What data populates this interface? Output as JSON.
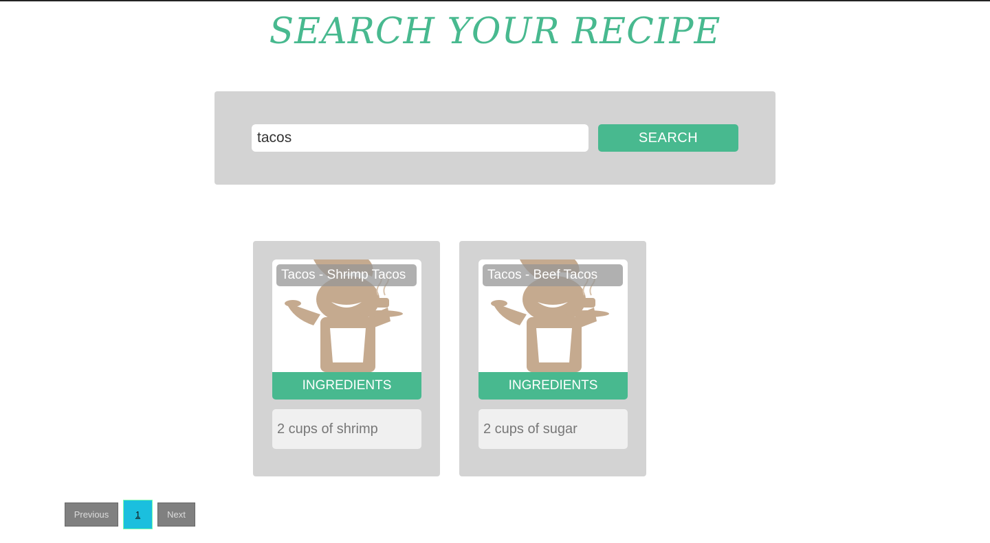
{
  "header": {
    "title": "SEARCH YOUR RECIPE"
  },
  "search": {
    "value": "tacos",
    "button_label": "SEARCH"
  },
  "cards": [
    {
      "title": "Tacos - Shrimp Tacos",
      "image_icon": "chef-waiter-icon",
      "button_label": "INGREDIENTS",
      "ingredients": "2 cups of shrimp"
    },
    {
      "title": "Tacos - Beef Tacos",
      "image_icon": "chef-waiter-icon",
      "button_label": "INGREDIENTS",
      "ingredients": "2 cups of sugar"
    }
  ],
  "pagination": {
    "previous_label": "Previous",
    "current_page": "1",
    "next_label": "Next"
  },
  "colors": {
    "accent": "#48b98f",
    "panel": "#d3d3d3",
    "active_page": "#1bbfde",
    "chef": "#b8997a"
  }
}
